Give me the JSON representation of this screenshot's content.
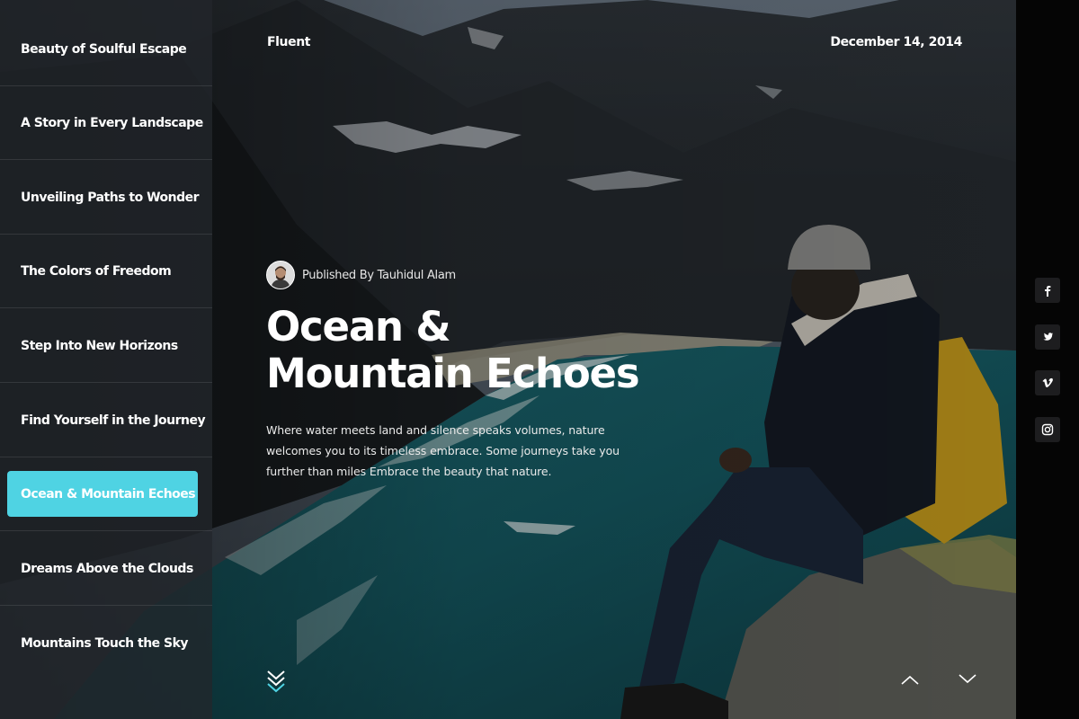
{
  "site": {
    "brand": "Fluent",
    "date": "December 14, 2014"
  },
  "sidebar": {
    "items": [
      {
        "label": "Beauty of Soulful Escape",
        "active": false
      },
      {
        "label": "A Story in Every Landscape",
        "active": false
      },
      {
        "label": "Unveiling Paths to Wonder",
        "active": false
      },
      {
        "label": "The Colors of Freedom",
        "active": false
      },
      {
        "label": "Step Into New Horizons",
        "active": false
      },
      {
        "label": "Find Yourself in the Journey",
        "active": false
      },
      {
        "label": "Ocean & Mountain Echoes",
        "active": true
      },
      {
        "label": "Dreams Above the Clouds",
        "active": false
      },
      {
        "label": "Mountains Touch the Sky",
        "active": false
      }
    ]
  },
  "article": {
    "author_line": "Published By Tauhidul Alam",
    "title": "Ocean & Mountain Echoes",
    "description": "Where water meets land and silence speaks volumes, nature welcomes you to its timeless embrace. Some journeys take you further than miles Embrace the beauty that nature."
  },
  "social": [
    {
      "icon": "facebook-icon"
    },
    {
      "icon": "twitter-icon"
    },
    {
      "icon": "vimeo-icon"
    },
    {
      "icon": "instagram-icon"
    }
  ],
  "colors": {
    "accent": "#4fd3e3",
    "sidebar_bg": "#22262b",
    "text": "#ffffff"
  }
}
